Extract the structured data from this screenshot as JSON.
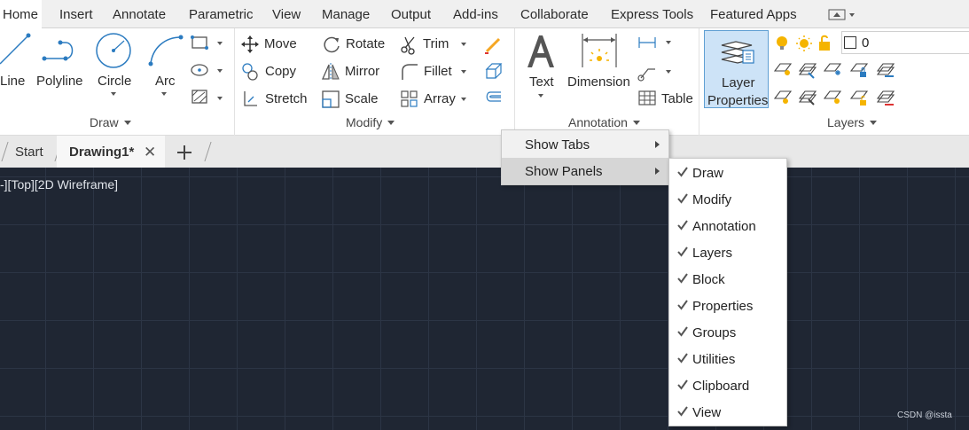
{
  "ribbon_tabs": [
    "Home",
    "Insert",
    "Annotate",
    "Parametric",
    "View",
    "Manage",
    "Output",
    "Add-ins",
    "Collaborate",
    "Express Tools",
    "Featured Apps"
  ],
  "draw": {
    "line": "Line",
    "polyline": "Polyline",
    "circle": "Circle",
    "arc": "Arc",
    "panel": "Draw"
  },
  "modify": {
    "move": "Move",
    "copy": "Copy",
    "stretch": "Stretch",
    "rotate": "Rotate",
    "mirror": "Mirror",
    "scale": "Scale",
    "trim": "Trim",
    "fillet": "Fillet",
    "array": "Array",
    "panel": "Modify"
  },
  "annotation": {
    "text": "Text",
    "dimension": "Dimension",
    "table": "Table",
    "panel": "Annotation"
  },
  "layers": {
    "layer_properties_line1": "Layer",
    "layer_properties_line2": "Properties",
    "current_layer": "0",
    "panel": "Layers"
  },
  "doc_tabs": {
    "start": "Start",
    "drawing": "Drawing1*"
  },
  "viewport_label": "-][Top][2D Wireframe]",
  "context_menu": {
    "show_tabs": "Show Tabs",
    "show_panels": "Show Panels"
  },
  "panels_submenu": [
    "Draw",
    "Modify",
    "Annotation",
    "Layers",
    "Block",
    "Properties",
    "Groups",
    "Utilities",
    "Clipboard",
    "View"
  ],
  "watermark": "CSDN @issta",
  "colors": {
    "canvas": "#1f2633",
    "highlight": "#cde3f7",
    "accent_blue": "#2b7bc0",
    "bulb_yellow": "#f5b400"
  }
}
